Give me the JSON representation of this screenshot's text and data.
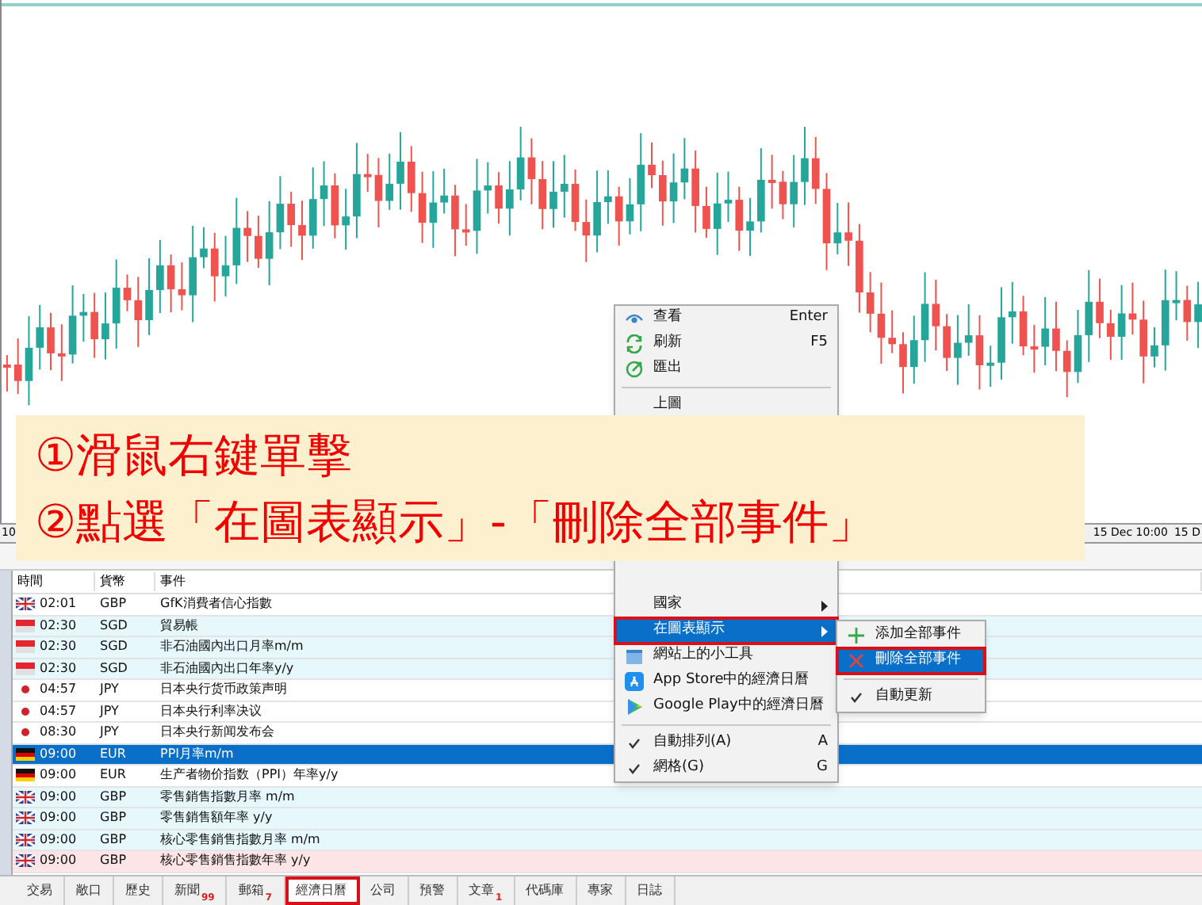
{
  "chart": {
    "axis_labels": [
      "10",
      "15 Dec 10:00",
      "15 D"
    ]
  },
  "annotation": {
    "lines": [
      "①滑鼠右鍵單擊",
      "②點選「在圖表顯示」-「刪除全部事件」"
    ]
  },
  "table": {
    "columns": [
      "時間",
      "貨幣",
      "事件"
    ],
    "rows": [
      {
        "time": "02:01",
        "currency": "GBP",
        "event": "GfK消費者信心指數",
        "color": "#ffffff",
        "selected": false
      },
      {
        "time": "02:30",
        "currency": "SGD",
        "event": "貿易帳",
        "color": "#e6f8fc",
        "selected": false
      },
      {
        "time": "02:30",
        "currency": "SGD",
        "event": "非石油國內出口月率m/m",
        "color": "#e6f8fc",
        "selected": false
      },
      {
        "time": "02:30",
        "currency": "SGD",
        "event": "非石油國內出口年率y/y",
        "color": "#e6f8fc",
        "selected": false
      },
      {
        "time": "04:57",
        "currency": "JPY",
        "event": "日本央行货币政策声明",
        "color": "#ffffff",
        "selected": false
      },
      {
        "time": "04:57",
        "currency": "JPY",
        "event": "日本央行利率决议",
        "color": "#ffffff",
        "selected": false
      },
      {
        "time": "08:30",
        "currency": "JPY",
        "event": "日本央行新闻发布会",
        "color": "#ffffff",
        "selected": false
      },
      {
        "time": "09:00",
        "currency": "EUR",
        "event": "PPI月率m/m",
        "selected": true
      },
      {
        "time": "09:00",
        "currency": "EUR",
        "event": "生产者物价指数（PPI）年率y/y",
        "color": "#ffffff",
        "selected": false
      },
      {
        "time": "09:00",
        "currency": "GBP",
        "event": "零售銷售指數月率 m/m",
        "color": "#e6f8fc",
        "selected": false
      },
      {
        "time": "09:00",
        "currency": "GBP",
        "event": "零售銷售額年率 y/y",
        "color": "#e6f8fc",
        "selected": false
      },
      {
        "time": "09:00",
        "currency": "GBP",
        "event": "核心零售銷售指數月率 m/m",
        "color": "#e6f8fc",
        "selected": false
      },
      {
        "time": "09:00",
        "currency": "GBP",
        "event": "核心零售銷售指數年率 y/y",
        "color": "#fde4e6",
        "selected": false
      }
    ]
  },
  "context_menu": {
    "items": [
      {
        "kind": "item",
        "label": "查看",
        "shortcut": "Enter",
        "selected": false,
        "outlined": false
      },
      {
        "kind": "item",
        "label": "刷新",
        "shortcut": "F5",
        "selected": false,
        "outlined": false
      },
      {
        "kind": "item",
        "label": "匯出",
        "selected": false,
        "outlined": false
      },
      {
        "kind": "separator"
      },
      {
        "kind": "item",
        "label": "上圖",
        "selected": false,
        "outlined": false
      },
      {
        "kind": "hidden"
      },
      {
        "kind": "item",
        "label": "國家",
        "selected": false,
        "outlined": false
      },
      {
        "kind": "item",
        "label": "在圖表顯示",
        "selected": true,
        "outlined": true
      },
      {
        "kind": "item",
        "label": "網站上的小工具",
        "selected": false,
        "outlined": false
      },
      {
        "kind": "item",
        "label": "App Store中的經濟日曆",
        "selected": false,
        "outlined": false
      },
      {
        "kind": "item",
        "label": "Google Play中的經濟日曆",
        "selected": false,
        "outlined": false
      },
      {
        "kind": "separator"
      },
      {
        "kind": "check",
        "label": "自動排列(A)",
        "shortcut": "A",
        "checked": true,
        "selected": false,
        "outlined": false
      },
      {
        "kind": "check",
        "label": "網格(G)",
        "shortcut": "G",
        "checked": true,
        "selected": false,
        "outlined": false
      }
    ]
  },
  "submenu": {
    "items": [
      {
        "kind": "item",
        "label": "添加全部事件",
        "selected": false,
        "outlined": false
      },
      {
        "kind": "item",
        "label": "刪除全部事件",
        "selected": true,
        "outlined": true
      },
      {
        "kind": "separator"
      },
      {
        "kind": "check",
        "label": "自動更新",
        "checked": true,
        "selected": false,
        "outlined": false
      }
    ]
  },
  "bottom_tabs": [
    {
      "label": "交易",
      "selected": false,
      "outlined": false
    },
    {
      "label": "敞口",
      "selected": false,
      "outlined": false
    },
    {
      "label": "歷史",
      "selected": false,
      "outlined": false
    },
    {
      "label": "新聞",
      "badge": "99",
      "selected": false,
      "outlined": false
    },
    {
      "label": "郵箱",
      "badge": "7",
      "selected": false,
      "outlined": false
    },
    {
      "label": "經濟日曆",
      "selected": true,
      "outlined": true
    },
    {
      "label": "公司",
      "selected": false,
      "outlined": false
    },
    {
      "label": "預警",
      "selected": false,
      "outlined": false
    },
    {
      "label": "文章",
      "badge": "1",
      "selected": false,
      "outlined": false
    },
    {
      "label": "代碼庫",
      "selected": false,
      "outlined": false
    },
    {
      "label": "專家",
      "selected": false,
      "outlined": false
    },
    {
      "label": "日誌",
      "selected": false,
      "outlined": false
    }
  ]
}
